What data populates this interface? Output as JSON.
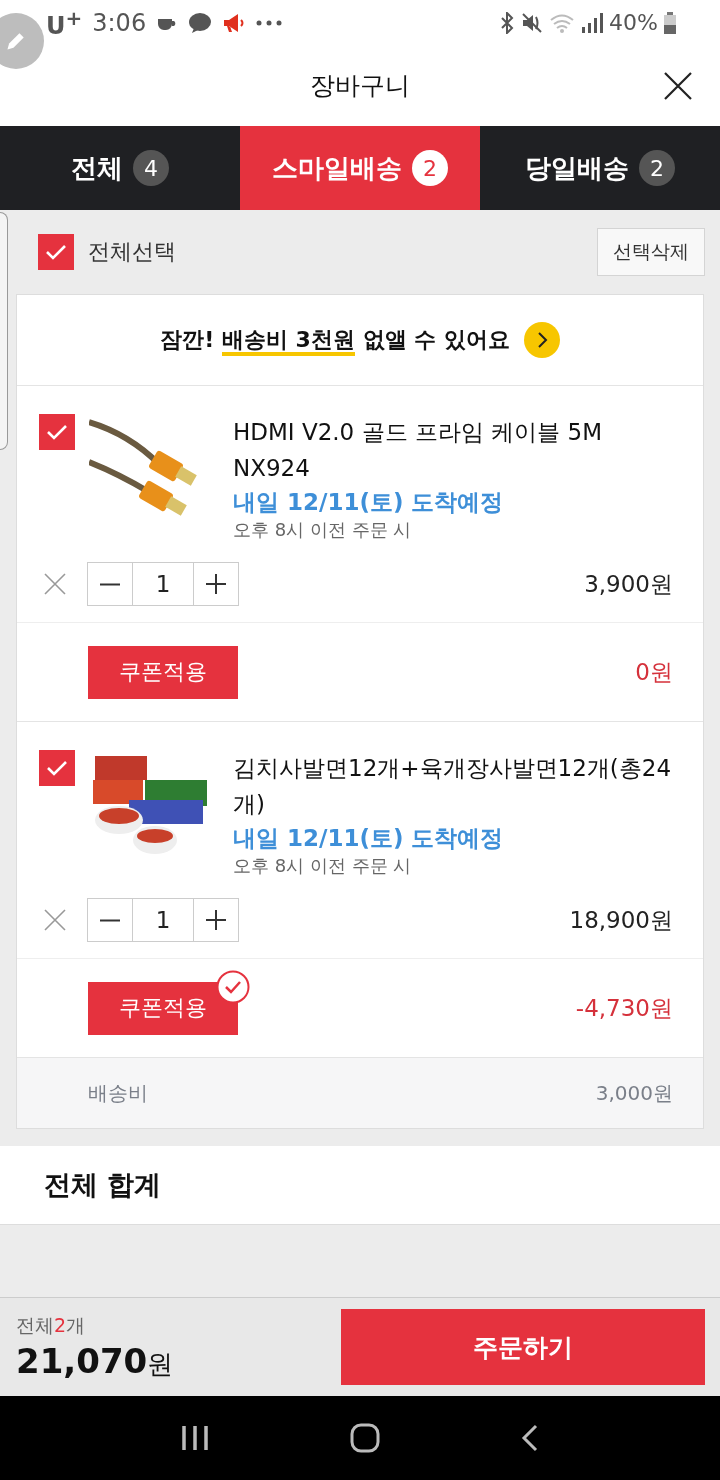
{
  "status_bar": {
    "carrier": "U$^{+}$",
    "time": "3:06",
    "battery": "40%"
  },
  "header": {
    "title": "장바구니"
  },
  "tabs": [
    {
      "label": "전체",
      "count": "4",
      "selected": false
    },
    {
      "label": "스마일배송",
      "count": "2",
      "selected": true
    },
    {
      "label": "당일배송",
      "count": "2",
      "selected": false
    }
  ],
  "select_all": {
    "label": "전체선택",
    "checked": true,
    "delete_button": "선택삭제"
  },
  "banner": {
    "before": "잠깐! ",
    "highlight": "배송비 3천원",
    "after": " 없앨 수 있어요"
  },
  "items": [
    {
      "checked": true,
      "name": "HDMI V2.0 골드 프라임 케이블 5M NX924",
      "kind": "cable",
      "delivery": "내일 12/11(토) 도착예정",
      "cutoff": "오후 8시 이전 주문 시",
      "quantity": "1",
      "price": "3,900원",
      "coupon_button": "쿠폰적용",
      "coupon_applied": false,
      "discount": "0원"
    },
    {
      "checked": true,
      "name": "김치사발면12개+육개장사발면12개(총24개)",
      "kind": "noodles",
      "delivery": "내일 12/11(토) 도착예정",
      "cutoff": "오후 8시 이전 주문 시",
      "quantity": "1",
      "price": "18,900원",
      "coupon_button": "쿠폰적용",
      "coupon_applied": true,
      "discount": "-4,730원"
    }
  ],
  "shipping": {
    "label": "배송비",
    "value": "3,000원"
  },
  "total_section": {
    "title": "전체 합계"
  },
  "footer": {
    "count_prefix": "전체",
    "count": "2",
    "count_suffix": "개",
    "total": "21,070",
    "currency": "원",
    "order_button": "주문하기"
  }
}
